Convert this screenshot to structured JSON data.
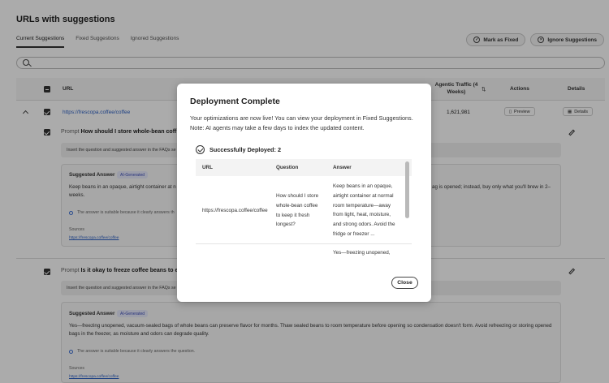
{
  "page": {
    "title": "URLs with suggestions",
    "tabs": [
      "Current Suggestions",
      "Fixed Suggestions",
      "Ignored Suggestions"
    ],
    "mark_fixed": "Mark as Fixed",
    "ignore": "Ignore Suggestions",
    "columns": {
      "url": "URL",
      "traffic": "Agentic Traffic (4 Weeks)",
      "actions": "Actions",
      "details": "Details"
    },
    "row": {
      "url": "https://frescopa.coffee/coffee",
      "traffic": "1,621,981",
      "preview": "Preview",
      "details": "Details"
    },
    "prompt_label": "Prompt",
    "insert_text": "Insert the question and suggested answer in the FAQs se",
    "insert_text_2": "Insert the question and suggested answer in the FAQs se",
    "suggested_answer": "Suggested Answer",
    "ai_badge": "AI-Generated",
    "sources": "Sources",
    "source_link": "https://frescopa.coffee/coffee",
    "items": [
      {
        "prompt": "How should I store whole-bean coff",
        "answer_left": "Keep beans in an opaque, airtight container at n",
        "answer_left_2": "weeks.",
        "answer_right": "ag is opened; instead, buy only what you'll brew in 2–",
        "hint": "The answer is suitable because it clearly answers th"
      },
      {
        "prompt": "Is it okay to freeze coffee beans to e",
        "answer_line1": "Yes—freezing unopened, vacuum-sealed bags of whole beans can preserve flavor for months. Thaw sealed beans to room temperature before opening so condensation doesn't form. Avoid refreezing or storing opened",
        "answer_line2": "bags in the freezer, as moisture and odors can degrade quality.",
        "hint": "The answer is suitable because it clearly answers the question."
      }
    ]
  },
  "modal": {
    "title": "Deployment Complete",
    "message_line1": "Your optimizations are now live! You can view your deployment in Fixed Suggestions.",
    "message_line2": "Note: AI agents may take a few days to index the updated content.",
    "success": "Successfully Deployed: 2",
    "columns": [
      "URL",
      "Question",
      "Answer"
    ],
    "rows": [
      {
        "url": "https://frescopa.coffee/coffee",
        "question_lines": [
          "How should I store",
          "whole-bean coffee",
          "to keep it fresh",
          "longest?"
        ],
        "answer_lines": [
          "Keep beans in an opaque,",
          "airtight container at normal",
          "room temperature—away",
          "from light, heat, moisture,",
          "and strong odors. Avoid the",
          "fridge or freezer ..."
        ]
      },
      {
        "answer_lines": [
          "Yes—freezing unopened,"
        ]
      }
    ],
    "close": "Close"
  },
  "colors": {
    "link": "#2b5fc4",
    "scrim": "rgba(0,0,0,0.33)",
    "badge_bg": "#e8eafc"
  }
}
